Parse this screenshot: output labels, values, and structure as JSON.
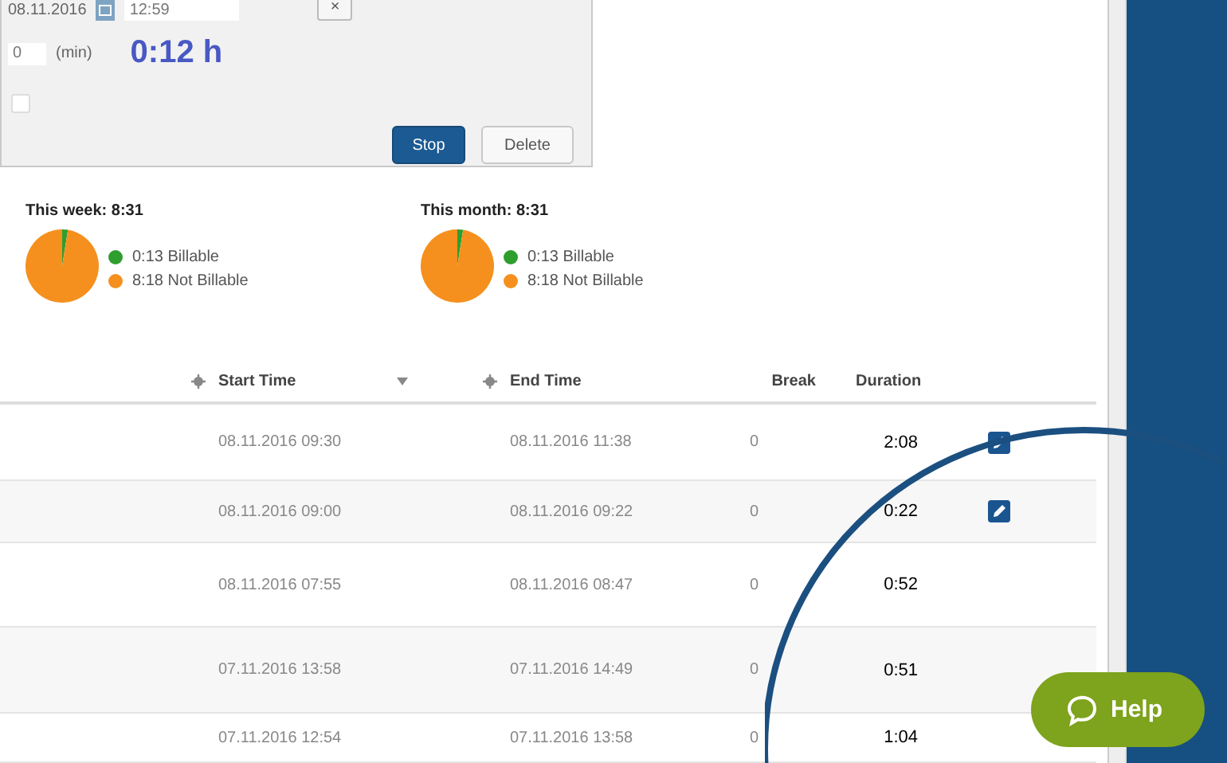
{
  "entry_panel": {
    "date": "08.11.2016",
    "time": "12:59",
    "clear_button": "×",
    "break_value": "0",
    "break_unit": "(min)",
    "elapsed": "0:12 h",
    "checkbox_checked": false,
    "buttons": [
      {
        "label": "Stop",
        "kind": "primary"
      },
      {
        "label": "Delete",
        "kind": "secondary"
      }
    ]
  },
  "summaries": [
    {
      "title": "This week: 8:31",
      "legend": [
        {
          "color": "#2f9e2f"
        },
        {
          "color": "#f5901e"
        }
      ],
      "chart_data": {
        "type": "pie",
        "categories": [
          "0:13 Billable",
          "8:18 Not Billable"
        ],
        "values": [
          2.54,
          97.46
        ]
      }
    },
    {
      "title": "This month: 8:31",
      "legend": [
        {
          "color": "#2f9e2f"
        },
        {
          "color": "#f5901e"
        }
      ],
      "chart_data": {
        "type": "pie",
        "categories": [
          "0:13 Billable",
          "8:18 Not Billable"
        ],
        "values": [
          2.54,
          97.46
        ]
      }
    }
  ],
  "table": {
    "columns": [
      "Start Time",
      "End Time",
      "Break",
      "Duration"
    ],
    "rows": [
      {
        "start": "08.11.2016 09:30",
        "end": "08.11.2016 11:38",
        "break": "0",
        "duration": "2:08",
        "editable": true
      },
      {
        "start": "08.11.2016 09:00",
        "end": "08.11.2016 09:22",
        "break": "0",
        "duration": "0:22",
        "editable": true
      },
      {
        "start": "08.11.2016 07:55",
        "end": "08.11.2016 08:47",
        "break": "0",
        "duration": "0:52",
        "editable": false
      },
      {
        "start": "07.11.2016 13:58",
        "end": "07.11.2016 14:49",
        "break": "0",
        "duration": "0:51",
        "editable": false
      },
      {
        "start": "07.11.2016 12:54",
        "end": "07.11.2016 13:58",
        "break": "0",
        "duration": "1:04",
        "editable": false
      }
    ]
  },
  "help_button": "Help"
}
